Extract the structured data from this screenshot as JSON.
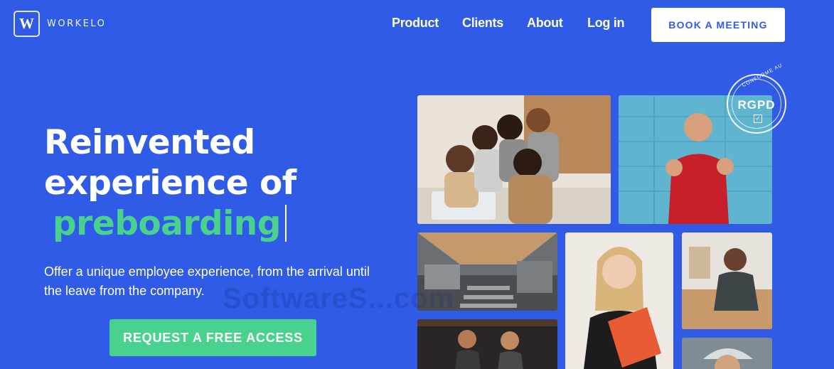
{
  "header": {
    "logo_letter": "W",
    "logo_text": "WORKELO",
    "nav": {
      "product": "Product",
      "clients": "Clients",
      "about": "About",
      "login": "Log in"
    },
    "book_meeting": "BOOK A MEETING"
  },
  "hero": {
    "title_line1": "Reinvented",
    "title_line2": "experience of",
    "title_accent": "preboarding",
    "subtitle": "Offer a unique employee experience, from the arrival until the leave from the company.",
    "cta": "REQUEST A FREE ACCESS"
  },
  "badge": {
    "arc_text": "CONFORME AU",
    "label": "RGPD",
    "check": "✓"
  },
  "watermark": "SoftwareS...com",
  "colors": {
    "background": "#2f5be7",
    "accent_green": "#49d28e",
    "white": "#ffffff"
  }
}
